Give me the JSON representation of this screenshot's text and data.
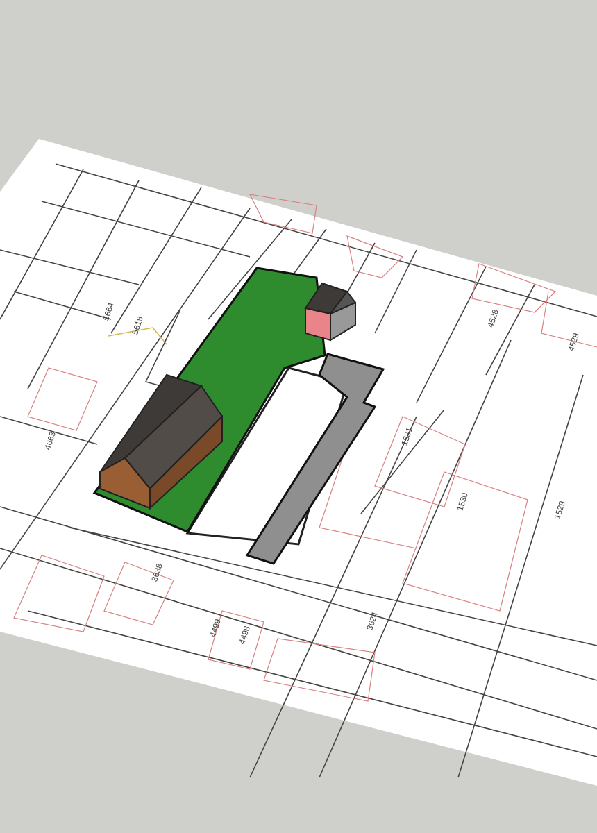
{
  "map": {
    "parcel_labels": [
      {
        "text": "1531"
      },
      {
        "text": "1530"
      },
      {
        "text": "1529"
      },
      {
        "text": "3624"
      },
      {
        "text": "4499"
      },
      {
        "text": "4498"
      },
      {
        "text": "3638"
      },
      {
        "text": "4663"
      },
      {
        "text": "5664"
      },
      {
        "text": "5618"
      },
      {
        "text": "4528"
      },
      {
        "text": "4529"
      }
    ]
  }
}
